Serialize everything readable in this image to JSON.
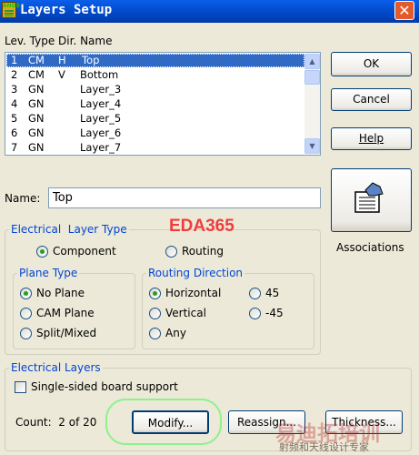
{
  "window": {
    "title": "Layers Setup",
    "icon_text": "ANDS"
  },
  "columns": {
    "header": "Lev. Type Dir. Name"
  },
  "layers": [
    {
      "lev": "1",
      "type": "CM",
      "dir": "H",
      "name": "Top"
    },
    {
      "lev": "2",
      "type": "CM",
      "dir": "V",
      "name": "Bottom"
    },
    {
      "lev": "3",
      "type": "GN",
      "dir": "",
      "name": "Layer_3"
    },
    {
      "lev": "4",
      "type": "GN",
      "dir": "",
      "name": "Layer_4"
    },
    {
      "lev": "5",
      "type": "GN",
      "dir": "",
      "name": "Layer_5"
    },
    {
      "lev": "6",
      "type": "GN",
      "dir": "",
      "name": "Layer_6"
    },
    {
      "lev": "7",
      "type": "GN",
      "dir": "",
      "name": "Layer_7"
    }
  ],
  "buttons": {
    "ok": "OK",
    "cancel": "Cancel",
    "help": "Help",
    "associations": "Associations",
    "modify": "Modify...",
    "reassign": "Reassign...",
    "thickness": "Thickness..."
  },
  "name_field": {
    "label": "Name:",
    "value": "Top"
  },
  "electrical_layer_type": {
    "label": "Electrical  Layer Type",
    "component": "Component",
    "routing": "Routing"
  },
  "plane_type": {
    "label": "Plane Type",
    "no_plane": "No Plane",
    "cam_plane": "CAM Plane",
    "split_mixed": "Split/Mixed"
  },
  "routing_direction": {
    "label": "Routing Direction",
    "horizontal": "Horizontal",
    "vertical": "Vertical",
    "any": "Any",
    "d45": "45",
    "dm45": "-45"
  },
  "electrical_layers": {
    "label": "Electrical Layers",
    "single_sided": "Single-sided board support",
    "count": "Count:  2 of 20"
  },
  "overlay": {
    "watermark": "EDA365",
    "cn_logo": "易迪拓培训",
    "cn_tagline": "射频和天线设计专家"
  },
  "colors": {
    "title_bar": "#0a5fe8",
    "selection": "#316ac5",
    "group_label": "#0046d5",
    "highlight": "#8cf28c"
  }
}
